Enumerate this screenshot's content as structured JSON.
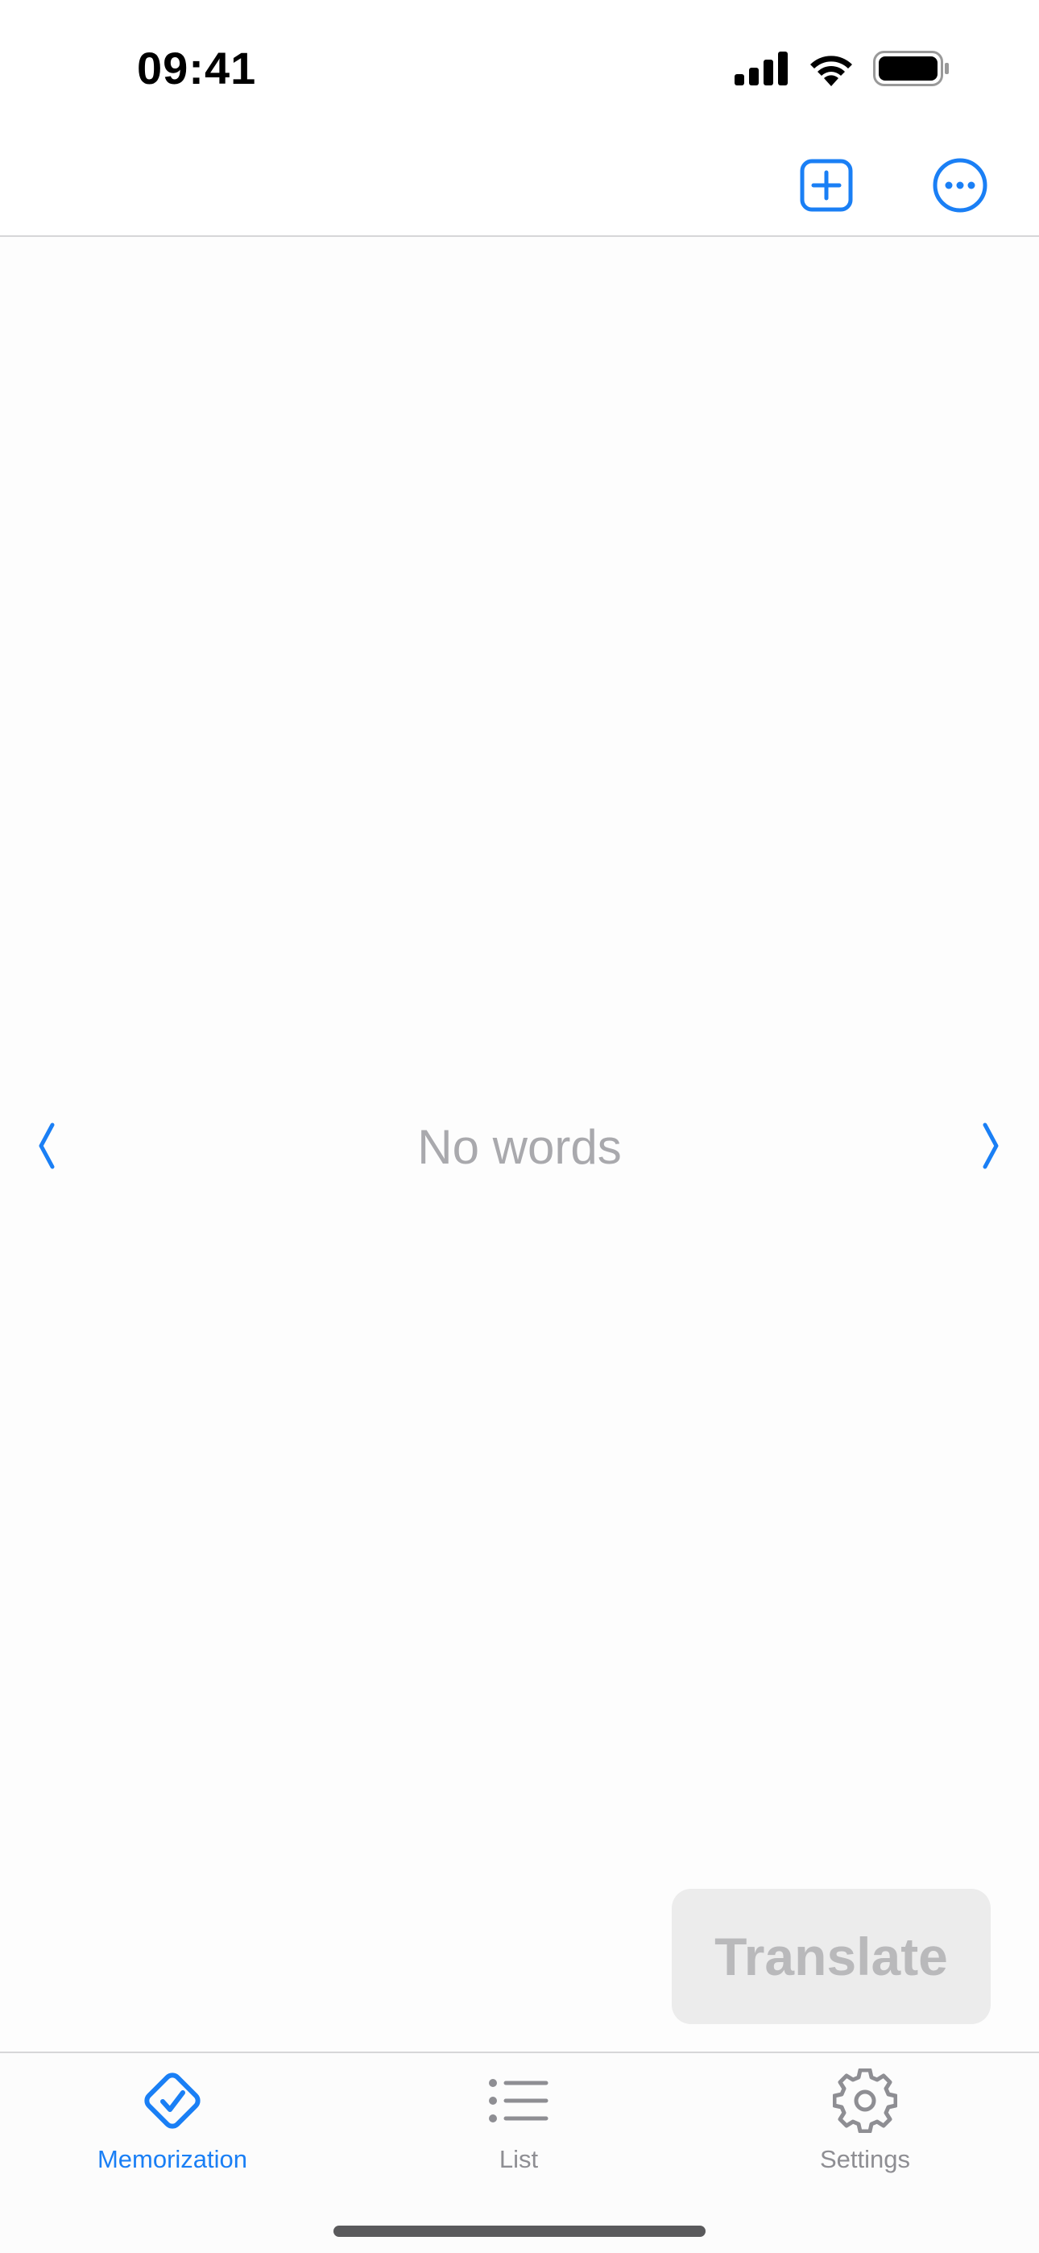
{
  "status_bar": {
    "time": "09:41"
  },
  "nav_bar": {
    "add_icon": "plus-square-icon",
    "more_icon": "ellipsis-circle-icon"
  },
  "content": {
    "empty_message": "No words",
    "prev_icon": "chevron-left-icon",
    "next_icon": "chevron-right-icon"
  },
  "translate_button": {
    "label": "Translate"
  },
  "tab_bar": {
    "tabs": [
      {
        "label": "Memorization",
        "icon": "checkmark-diamond-icon",
        "active": true
      },
      {
        "label": "List",
        "icon": "list-bullet-icon",
        "active": false
      },
      {
        "label": "Settings",
        "icon": "gear-icon",
        "active": false
      }
    ]
  },
  "colors": {
    "accent": "#1a7ff5",
    "inactive": "#8e8e93",
    "placeholder_text": "#a9a9ad",
    "disabled_button_bg": "#ececec",
    "disabled_button_text": "#b9b9bb"
  }
}
